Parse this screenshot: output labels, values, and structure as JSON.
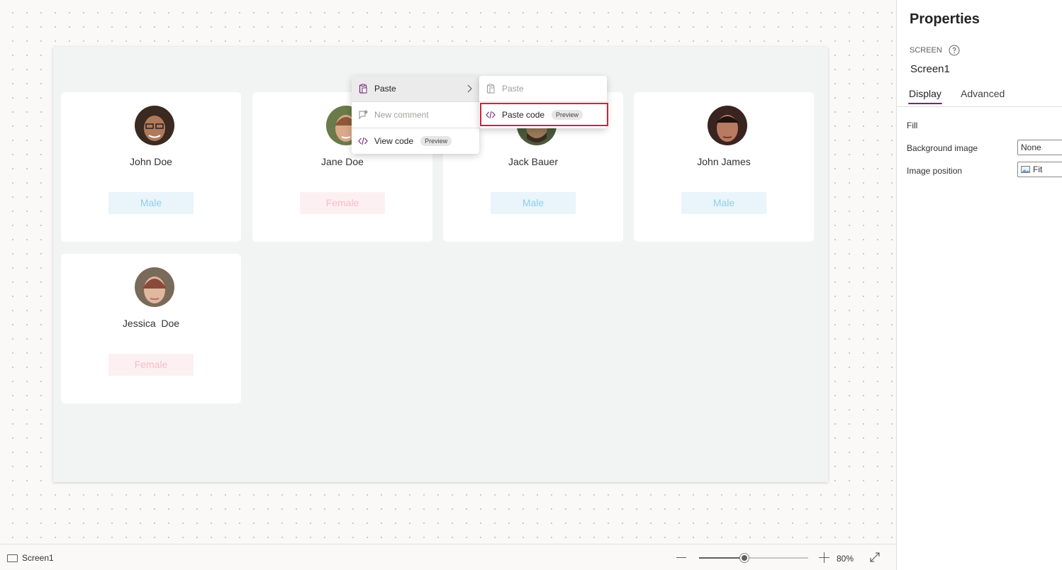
{
  "canvas": {
    "cards": [
      {
        "name": "John Doe",
        "gender": "Male",
        "avatar_tone": "#6b4a3a"
      },
      {
        "name": "Jane Doe",
        "gender": "Female",
        "avatar_tone": "#c79a7c"
      },
      {
        "name": "Jack Bauer",
        "gender": "Male",
        "avatar_tone": "#5e4a3a"
      },
      {
        "name": "John James",
        "gender": "Male",
        "avatar_tone": "#7a4a3a"
      },
      {
        "name": "Jessica  Doe",
        "gender": "Female",
        "avatar_tone": "#caa08a"
      }
    ]
  },
  "context_menu": {
    "items": [
      {
        "label": "Paste",
        "icon": "paste-icon",
        "state": "active",
        "has_submenu": true
      },
      {
        "label": "New comment",
        "icon": "comment-icon",
        "state": "disabled"
      },
      {
        "label": "View code",
        "icon": "code-icon",
        "badge": "Preview"
      }
    ],
    "submenu": {
      "items": [
        {
          "label": "Paste",
          "icon": "paste-icon",
          "state": "disabled"
        },
        {
          "label": "Paste code",
          "icon": "code-icon",
          "badge": "Preview",
          "highlighted": true
        }
      ]
    }
  },
  "bottom_bar": {
    "screen_name": "Screen1",
    "zoom_label": "80%",
    "zoom_level_percent": 80
  },
  "properties": {
    "title": "Properties",
    "kind": "SCREEN",
    "name": "Screen1",
    "tabs": [
      {
        "label": "Display",
        "active": true
      },
      {
        "label": "Advanced",
        "active": false
      }
    ],
    "fields": [
      {
        "label": "Fill",
        "value": ""
      },
      {
        "label": "Background image",
        "value": "None"
      },
      {
        "label": "Image position",
        "value": "Fit"
      }
    ]
  },
  "colors": {
    "accent": "#742774",
    "highlight_border": "#d72230",
    "male_chip_bg": "#eaf4fb",
    "male_chip_text": "#8fd0e8",
    "female_chip_bg": "#fdf0f2",
    "female_chip_text": "#f7bcc8"
  }
}
